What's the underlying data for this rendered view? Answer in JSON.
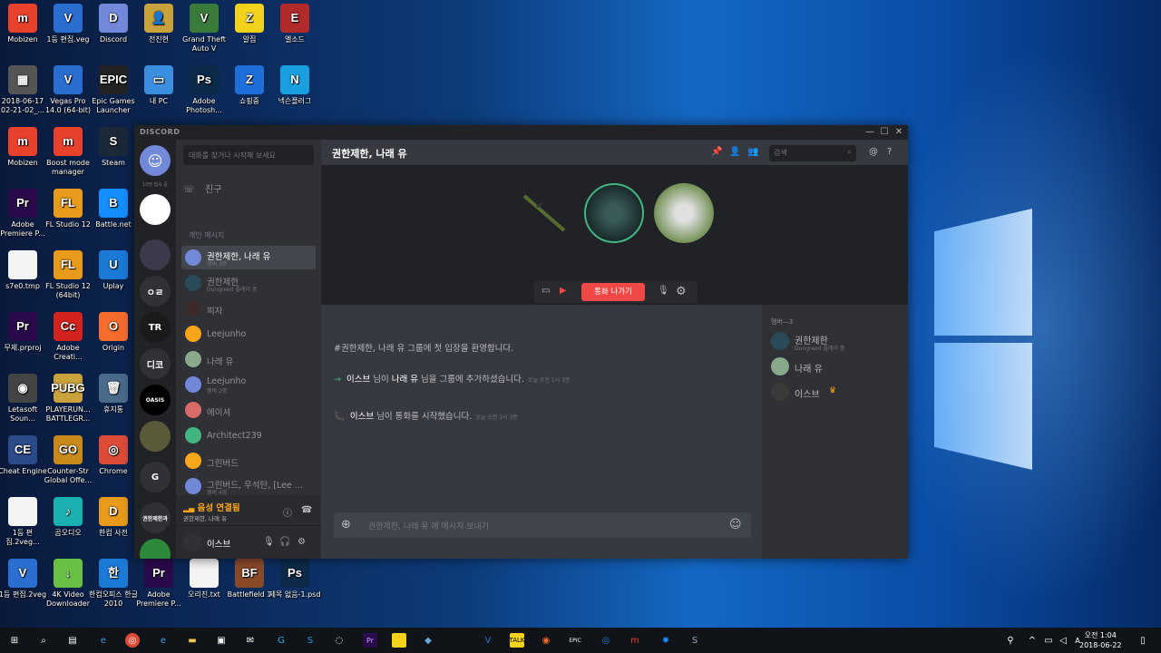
{
  "desktop": {
    "icons": [
      {
        "label": "Mobizen",
        "glyph": "m",
        "color": "#e8412c"
      },
      {
        "label": "1등 편집.veg",
        "glyph": "V",
        "color": "#2a6ecf"
      },
      {
        "label": "Discord",
        "glyph": "D",
        "color": "#7289da"
      },
      {
        "label": "전진현",
        "glyph": "👤",
        "color": "#c9a23b"
      },
      {
        "label": "Grand Theft Auto V",
        "glyph": "V",
        "color": "#3a7a3a"
      },
      {
        "label": "알집",
        "glyph": "Z",
        "color": "#f2d21b"
      },
      {
        "label": "엘소드",
        "glyph": "E",
        "color": "#b02a2a"
      },
      {
        "label": "2018-06-17 02-21-02_...",
        "glyph": "▦",
        "color": "#555"
      },
      {
        "label": "Vegas Pro 14.0 (64-bit)",
        "glyph": "V",
        "color": "#2a6ecf"
      },
      {
        "label": "Epic Games Launcher",
        "glyph": "EPIC",
        "color": "#222"
      },
      {
        "label": "내 PC",
        "glyph": "▭",
        "color": "#3b8ee0"
      },
      {
        "label": "Adobe Photosh...",
        "glyph": "Ps",
        "color": "#0b2a4a"
      },
      {
        "label": "쇼핑중",
        "glyph": "Z",
        "color": "#1e6fd9"
      },
      {
        "label": "넥슨플러그",
        "glyph": "N",
        "color": "#1aa0e0"
      },
      {
        "label": "Mobizen",
        "glyph": "m",
        "color": "#e8412c"
      },
      {
        "label": "Boost mode manager",
        "glyph": "m",
        "color": "#e8412c"
      },
      {
        "label": "Steam",
        "glyph": "S",
        "color": "#1b2838"
      },
      {
        "label": "Adobe Premiere P...",
        "glyph": "Pr",
        "color": "#2a0a4a"
      },
      {
        "label": "FL Studio 12",
        "glyph": "FL",
        "color": "#e89a1b"
      },
      {
        "label": "Battle.net",
        "glyph": "B",
        "color": "#148eff"
      },
      {
        "label": "s7e0.tmp",
        "glyph": "",
        "color": "#f4f4f4"
      },
      {
        "label": "FL Studio 12 (64bit)",
        "glyph": "FL",
        "color": "#e89a1b"
      },
      {
        "label": "Uplay",
        "glyph": "U",
        "color": "#1a7ad6"
      },
      {
        "label": "무제.prproj",
        "glyph": "Pr",
        "color": "#2a0a4a"
      },
      {
        "label": "Adobe Creati...",
        "glyph": "Cc",
        "color": "#d4231f"
      },
      {
        "label": "Origin",
        "glyph": "O",
        "color": "#f56c2d"
      },
      {
        "label": "Letasoft Soun...",
        "glyph": "◉",
        "color": "#444"
      },
      {
        "label": "PLAYERUN... BATTLEGR...",
        "glyph": "PUBG",
        "color": "#c9a23b"
      },
      {
        "label": "휴지통",
        "glyph": "🗑",
        "color": "#4a6a8a"
      },
      {
        "label": "Cheat Engine",
        "glyph": "CE",
        "color": "#2a4a8a"
      },
      {
        "label": "Counter-Str Global Offe...",
        "glyph": "GO",
        "color": "#c98a1b"
      },
      {
        "label": "Chrome",
        "glyph": "◎",
        "color": "#dd4b39"
      },
      {
        "label": "1등 편집.2veg...",
        "glyph": "",
        "color": "#f4f4f4"
      },
      {
        "label": "곰오디오",
        "glyph": "♪",
        "color": "#1ab0b0"
      },
      {
        "label": "한컴 사전",
        "glyph": "D",
        "color": "#e89a1b"
      },
      {
        "label": "1등 편집.2veg",
        "glyph": "V",
        "color": "#2a6ecf"
      },
      {
        "label": "4K Video Downloader",
        "glyph": "↓",
        "color": "#6ac045"
      },
      {
        "label": "한컴오피스 한글 2010",
        "glyph": "한",
        "color": "#1a7ad6"
      },
      {
        "label": "Adobe Premiere P...",
        "glyph": "Pr",
        "color": "#2a0a4a"
      },
      {
        "label": "오리진.txt",
        "glyph": "",
        "color": "#f4f4f4"
      },
      {
        "label": "Battlefield 1",
        "glyph": "BF",
        "color": "#8a4a2a"
      },
      {
        "label": "제목 없음-1.psd",
        "glyph": "Ps",
        "color": "#0b2a4a"
      }
    ]
  },
  "discord": {
    "brand": "DISCORD",
    "window_controls": {
      "minimize": "—",
      "maximize": "☐",
      "close": "✕"
    },
    "guilds": {
      "online_label": "10명 접속 중",
      "items": [
        {
          "label": "",
          "color": "#7289da"
        },
        {
          "label": "",
          "color": "#ffffff"
        },
        {
          "label": "",
          "color": "#3a3a4a"
        },
        {
          "label": "ㅇㄹ",
          "color": "#2f3136"
        },
        {
          "label": "TR",
          "color": "#1a1a1a"
        },
        {
          "label": "디코",
          "color": "#2f3136"
        },
        {
          "label": "OASIS",
          "color": "#000000"
        },
        {
          "label": "",
          "color": "#5a5a3a"
        },
        {
          "label": "G",
          "color": "#2f3136"
        },
        {
          "label": "권한제한과",
          "color": "#2f3136"
        },
        {
          "label": "",
          "color": "#2a8a3a"
        }
      ]
    },
    "channels": {
      "search_placeholder": "대화를 찾거나 시작해 보세요",
      "friends_label": "친구",
      "dm_header": "개인 메시지",
      "dms": [
        {
          "name": "권한제한, 나래 유",
          "sub": "멤버 3명",
          "active": true,
          "color": "#7289da"
        },
        {
          "name": "권한제한",
          "sub": "Dungreed 플레이 중",
          "active": false,
          "color": "#2a4a5a"
        },
        {
          "name": "피자",
          "sub": "",
          "active": false,
          "color": "#3a2a2a"
        },
        {
          "name": "Leejunho",
          "sub": "",
          "active": false,
          "color": "#faa61a"
        },
        {
          "name": "나래 유",
          "sub": "",
          "active": false,
          "color": "#8aa88a"
        },
        {
          "name": "Leejunho",
          "sub": "멤버 2명",
          "active": false,
          "color": "#7289da"
        },
        {
          "name": "에이셔",
          "sub": "",
          "active": false,
          "color": "#d86a6a"
        },
        {
          "name": "Architect239",
          "sub": "",
          "active": false,
          "color": "#43b581"
        },
        {
          "name": "그린버드",
          "sub": "",
          "active": false,
          "color": "#faa61a"
        },
        {
          "name": "그린버드, 우석탄, [Lee ...",
          "sub": "멤버 4명",
          "active": false,
          "color": "#7289da"
        }
      ]
    },
    "voice": {
      "status": "음성 연결됨",
      "channel": "권한제한, 나래 유"
    },
    "user": {
      "name": "이스브"
    },
    "chat": {
      "title": "권한제한, 나래 유",
      "search_placeholder": "검색",
      "leave_call": "통화 나가기",
      "welcome": "#권한제한, 나래 유 그룹에 첫 입장을 환영합니다.",
      "messages": [
        {
          "icon": "→",
          "icon_color": "#43b581",
          "actor": "이스브",
          "mid": " 님이 ",
          "target": "나래 유",
          "rest": " 님을 그룹에 추가하셨습니다.",
          "time": "오늘 오전 1시 3분"
        },
        {
          "icon": "📞",
          "icon_color": "#43b581",
          "actor": "이스브",
          "mid": " 님이 통화를 시작했습니다.",
          "target": "",
          "rest": "",
          "time": "오늘 오전 1시 3분"
        }
      ],
      "input_placeholder": "권한제한, 나래 유 에 메시지 보내기"
    },
    "members": {
      "header": "멤버—3",
      "items": [
        {
          "name": "권한제한",
          "sub": "Dungreed 플레이 중",
          "color": "#2a4a5a"
        },
        {
          "name": "나래 유",
          "sub": "",
          "color": "#8aa88a"
        },
        {
          "name": "이스브",
          "sub": "",
          "color": "#3a3a3a",
          "owner": "♛"
        }
      ]
    }
  },
  "taskbar": {
    "time": "오전 1:04",
    "date": "2018-06-22"
  }
}
